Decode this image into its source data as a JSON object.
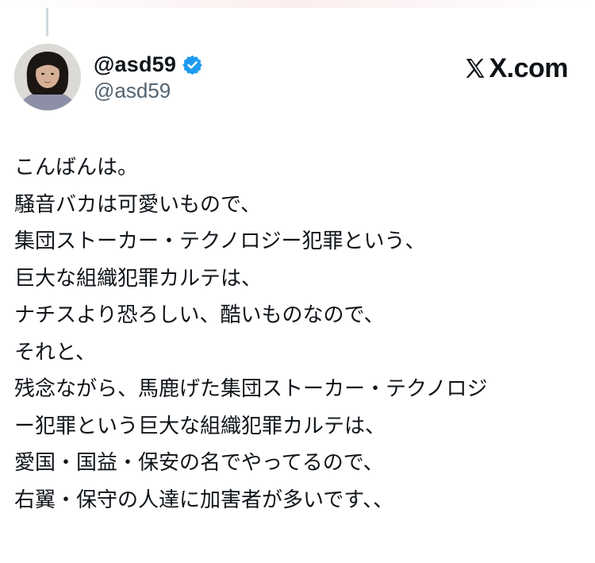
{
  "tweet": {
    "display_name": "@asd59",
    "handle": "@asd59",
    "verified_icon": "verified-badge-icon",
    "brand_text": "X.com",
    "lines": [
      "こんばんは。",
      "騒音バカは可愛いもので、",
      "集団ストーカー・テクノロジー犯罪という、",
      "巨大な組織犯罪カルテは、",
      "ナチスより恐ろしい、酷いものなので、",
      "それと、",
      "残念ながら、馬鹿げた集団ストーカー・テクノロジ",
      "ー犯罪という巨大な組織犯罪カルテは、",
      "愛国・国益・保安の名でやってるので、",
      "右翼・保守の人達に加害者が多いです、、"
    ]
  },
  "colors": {
    "text": "#0f1419",
    "secondary": "#536471",
    "verified": "#1d9bf0",
    "thread_line": "#cfd9de"
  }
}
